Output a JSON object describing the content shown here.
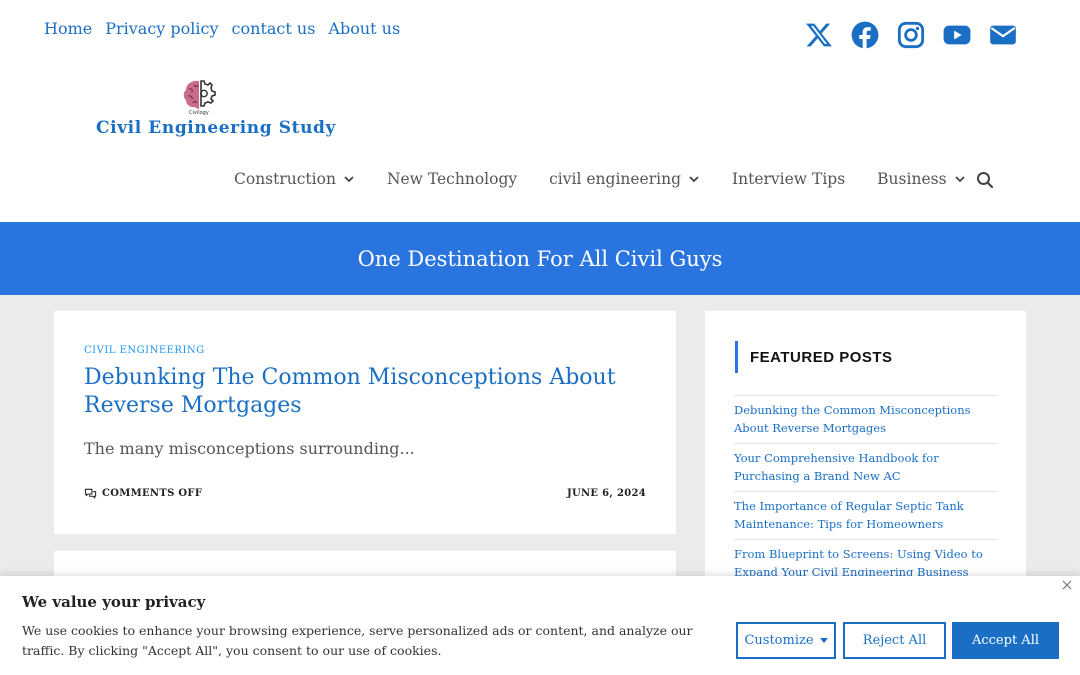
{
  "topnav": {
    "items": [
      "Home",
      "Privacy policy",
      "contact us",
      "About us"
    ]
  },
  "social": [
    "x-icon",
    "facebook-icon",
    "instagram-icon",
    "youtube-icon",
    "envelope-icon"
  ],
  "brand": {
    "logo_small_text": "Civilogy",
    "site_title": "Civil  Engineering  Study",
    "color": "#1a6fc4"
  },
  "mainnav": {
    "items": [
      {
        "label": "Construction",
        "dropdown": true
      },
      {
        "label": "New Technology",
        "dropdown": false
      },
      {
        "label": "civil engineering",
        "dropdown": true
      },
      {
        "label": "Interview Tips",
        "dropdown": false
      },
      {
        "label": "Business",
        "dropdown": true
      }
    ]
  },
  "banner": {
    "text": "One Destination For All Civil Guys",
    "color": "#2a74e0"
  },
  "post": {
    "category": "CIVIL ENGINEERING",
    "title": "Debunking The Common Misconceptions About Reverse Mortgages",
    "excerpt": "The many misconceptions surrounding...",
    "comments": "COMMENTS OFF",
    "date": "JUNE 6, 2024"
  },
  "sidebar": {
    "heading": "FEATURED POSTS",
    "posts": [
      "Debunking the Common Misconceptions About Reverse Mortgages",
      "Your Comprehensive Handbook for Purchasing a Brand New AC",
      "The Importance of Regular Septic Tank Maintenance: Tips for Homeowners",
      "From Blueprint to Screens: Using Video to Expand Your Civil Engineering Business"
    ]
  },
  "cookie": {
    "title": "We value your privacy",
    "text": "We use cookies to enhance your browsing experience, serve personalized ads or content, and analyze our traffic. By clicking \"Accept All\", you consent to our use of cookies.",
    "customize": "Customize",
    "reject": "Reject All",
    "accept": "Accept All"
  }
}
